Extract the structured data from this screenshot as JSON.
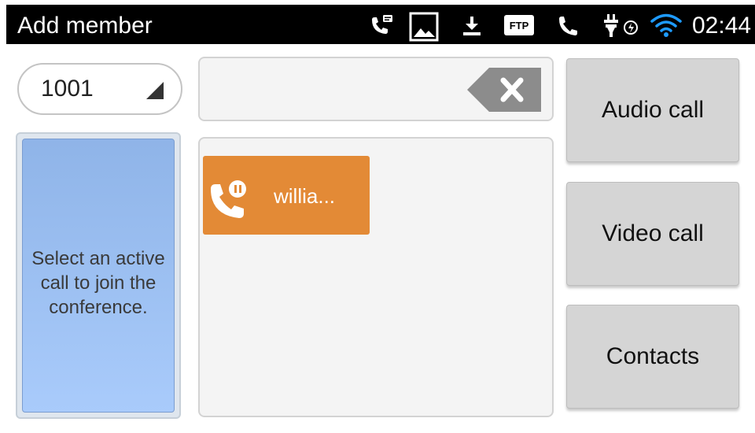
{
  "status_bar": {
    "title": "Add member",
    "time": "02:44",
    "ftp_badge": "FTP",
    "icons": [
      "voicemail-call-icon",
      "image-icon",
      "download-icon",
      "ftp-icon",
      "phone-icon",
      "usb-power-icon",
      "wifi-icon"
    ]
  },
  "account": {
    "selected": "1001"
  },
  "hint": {
    "text": "Select an active\ncall to join the\nconference."
  },
  "dial_input": {
    "value": ""
  },
  "active_calls": [
    {
      "name": "willia...",
      "icon": "phone-hold-icon",
      "color": "#e38a36"
    }
  ],
  "actions": {
    "audio_call": "Audio call",
    "video_call": "Video call",
    "contacts": "Contacts"
  },
  "colors": {
    "status_bar": "#000000",
    "wifi": "#1e9bff",
    "hint_panel": "#a9cbfb",
    "call_tile": "#e38a36",
    "button": "#d5d5d5"
  }
}
